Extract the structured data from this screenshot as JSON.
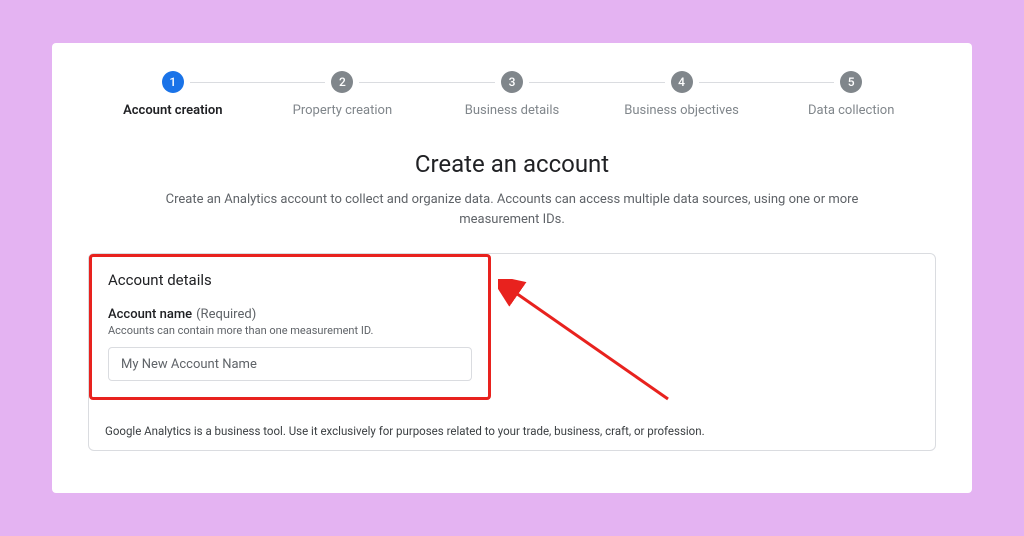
{
  "stepper": {
    "steps": [
      {
        "num": "1",
        "label": "Account creation"
      },
      {
        "num": "2",
        "label": "Property creation"
      },
      {
        "num": "3",
        "label": "Business details"
      },
      {
        "num": "4",
        "label": "Business objectives"
      },
      {
        "num": "5",
        "label": "Data collection"
      }
    ]
  },
  "heading": {
    "title": "Create an account",
    "subtitle": "Create an Analytics account to collect and organize data. Accounts can access multiple data sources, using one or more measurement IDs."
  },
  "details": {
    "section_title": "Account details",
    "field_label": "Account name",
    "field_required": "(Required)",
    "field_helper": "Accounts can contain more than one measurement ID.",
    "field_value": "My New Account Name"
  },
  "disclaimer": "Google Analytics is a business tool. Use it exclusively for purposes related to your trade, business, craft, or profession."
}
